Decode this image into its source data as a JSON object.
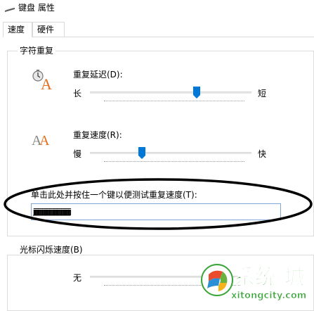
{
  "window": {
    "title": "键盘 属性"
  },
  "tabs": [
    {
      "label": "速度"
    },
    {
      "label": "硬件"
    }
  ],
  "repeat_group": {
    "title": "字符重复",
    "delay": {
      "label": "重复延迟(D):",
      "min_label": "长",
      "max_label": "短",
      "value_fraction": 0.66
    },
    "rate": {
      "label": "重复速度(R):",
      "min_label": "慢",
      "max_label": "快",
      "value_fraction": 0.32
    },
    "test": {
      "label": "单击此处并按住一个键以便测试重复速度(T):",
      "value": "jjjjjjjjjjjjjjjjjjjjjjjjjjjjjjjjjjjjjjjjjjjjjjjjjjjjjjjjjjjjjjj"
    }
  },
  "cursor_group": {
    "title": "光标闪烁速度(B)",
    "blink": {
      "min_label": "无",
      "value_fraction": 0.74
    }
  },
  "watermark": {
    "brand": "系统城",
    "url": "xitongcity.com"
  },
  "colors": {
    "accent": "#0078d7",
    "border": "#dcdcdc",
    "ellipse": "#000000",
    "watermark_green": "#3aa63a"
  }
}
